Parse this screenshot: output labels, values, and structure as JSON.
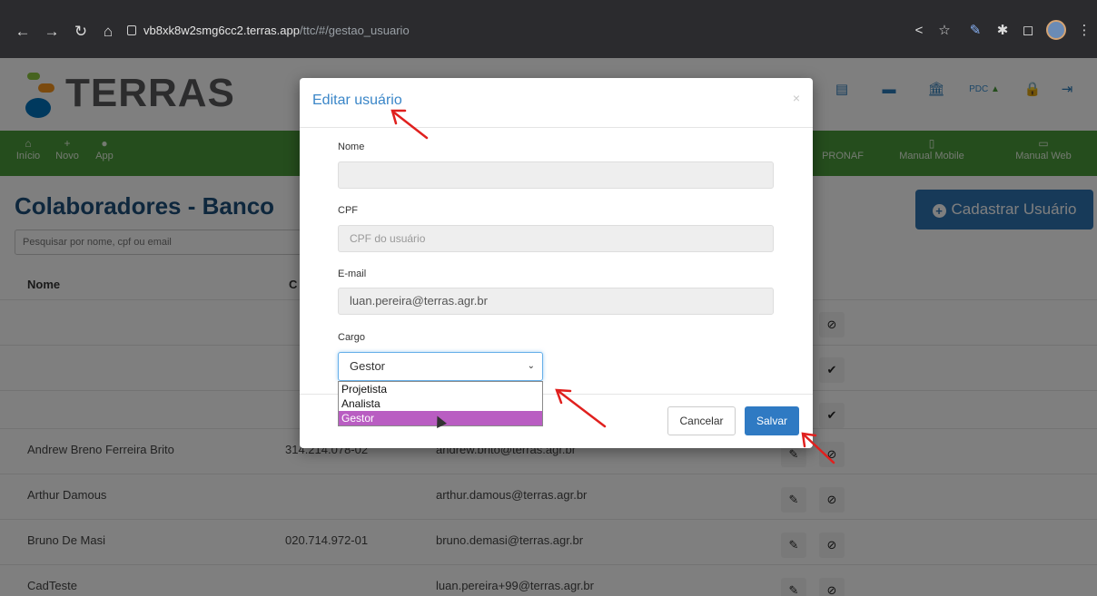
{
  "browser": {
    "url_host": "vb8xk8w2smg6cc2.terras.app",
    "url_path": "/ttc/#/gestao_usuario",
    "icons": [
      "back-icon",
      "forward-icon",
      "reload-icon",
      "home-icon",
      "lock-icon",
      "share-icon",
      "star-icon",
      "extension-icon",
      "puzzle-icon",
      "window-icon",
      "profile-avatar",
      "menu-dots-icon"
    ]
  },
  "header": {
    "logo_text": "TERRAS",
    "pdc_label": "PDC"
  },
  "nav": {
    "items": [
      {
        "label": "Início"
      },
      {
        "label": "Novo"
      },
      {
        "label": "App"
      },
      {
        "label": "PRONAF"
      },
      {
        "label": "Manual Mobile"
      },
      {
        "label": "Manual Web"
      }
    ]
  },
  "page": {
    "title": "Colaboradores - Banco",
    "search_placeholder": "Pesquisar por nome, cpf ou email",
    "add_button": "Cadastrar Usuário",
    "columns": {
      "name": "Nome",
      "cpf": "C"
    }
  },
  "table": {
    "rows": [
      {
        "name": "Andrew Breno Ferreira Brito",
        "cpf": "314.214.078-02",
        "email": "andrew.brito@terras.agr.br"
      },
      {
        "name": "Arthur Damous",
        "cpf": "",
        "email": "arthur.damous@terras.agr.br"
      },
      {
        "name": "Bruno De Masi",
        "cpf": "020.714.972-01",
        "email": "bruno.demasi@terras.agr.br"
      },
      {
        "name": "CadTeste",
        "cpf": "",
        "email": "luan.pereira+99@terras.agr.br"
      }
    ]
  },
  "modal": {
    "title": "Editar usuário",
    "close": "×",
    "name_label": "Nome",
    "name_value": "",
    "cpf_label": "CPF",
    "cpf_placeholder": "CPF do usuário",
    "email_label": "E-mail",
    "email_value": "luan.pereira@terras.agr.br",
    "role_label": "Cargo",
    "role_selected": "Gestor",
    "role_options": [
      "Projetista",
      "Analista",
      "Gestor"
    ],
    "cancel": "Cancelar",
    "save": "Salvar"
  },
  "colors": {
    "brand_blue": "#2f74b3",
    "nav_green": "#4a9a3a",
    "title_blue": "#1c4f7a",
    "annotation_red": "#e0201e",
    "option_highlight": "#b95dc2"
  }
}
